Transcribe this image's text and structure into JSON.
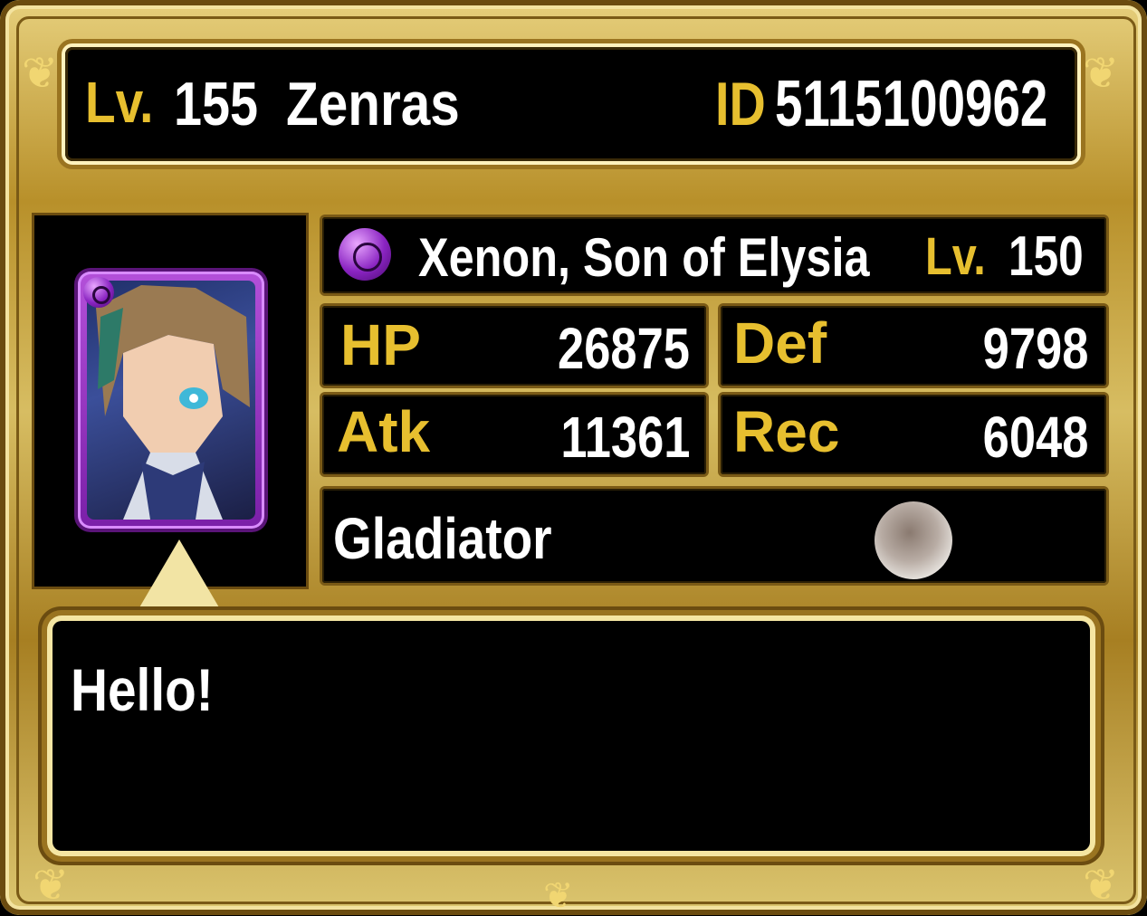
{
  "player": {
    "lv_label": "Lv.",
    "level": "155",
    "name": "Zenras",
    "id_label": "ID",
    "id": "5115100962"
  },
  "unit": {
    "name": "Xenon, Son of Elysia",
    "lv_label": "Lv.",
    "level": "150",
    "element_icon": "dark-element-icon"
  },
  "stats": {
    "hp_label": "HP",
    "hp": "26875",
    "def_label": "Def",
    "def": "9798",
    "atk_label": "Atk",
    "atk": "11361",
    "rec_label": "Rec",
    "rec": "6048"
  },
  "type": {
    "label": "Gladiator"
  },
  "message": {
    "text": "Hello!"
  },
  "colors": {
    "gold": "#e7bf2f",
    "frame": "#c9a94a",
    "panel": "#000000",
    "element": "#8a24c2"
  }
}
